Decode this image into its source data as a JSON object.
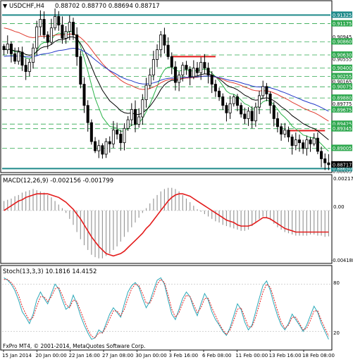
{
  "header": {
    "symbol": "USDCHF,H4",
    "ohlc": "0.88702 0.88770 0.88694 0.88717"
  },
  "macd": {
    "label": "MACD(12,26,9) -0.002156 -0.001799",
    "ticks": [
      "0.002177",
      "0.00",
      "-0.004188"
    ]
  },
  "stoch": {
    "label": "Stoch(13,3,3) 10.1816 14.4152",
    "ticks": [
      "80",
      "20"
    ]
  },
  "footer": {
    "copyright": "FxPro MT4, © 2001-2014, MetaQuotes Software Corp."
  },
  "x_labels": [
    "15 Jan 2014",
    "20 Jan 00:00",
    "22 Jan 16:00",
    "27 Jan 08:00",
    "30 Jan 00:00",
    "3 Feb 16:00",
    "6 Feb 08:00",
    "11 Feb 00:00",
    "13 Feb 16:00",
    "18 Feb 08:00"
  ],
  "price_labels": {
    "plain": [
      "0.90945",
      "0.90555",
      "0.90165",
      "0.89775",
      "0.89385",
      "0.88995",
      "0.88605"
    ],
    "green": [
      "0.91175",
      "0.90860",
      "0.90630",
      "0.90400",
      "0.90255",
      "0.90075",
      "0.89880",
      "0.89675",
      "0.89425",
      "0.89345",
      "0.89005"
    ],
    "teal": [
      "0.91325",
      "0.88650"
    ],
    "current": "0.88717"
  },
  "colors": {
    "candle": "#000000",
    "ema_fast": "#2bb34a",
    "ema_mid": "#000000",
    "ema_slow_red": "#e03a2e",
    "ema_slow_blue": "#2237c8",
    "teal_level": "#1f8a8a",
    "green_level": "#2fa84f",
    "red_level": "#e31b1b",
    "macd_signal": "#e31b1b",
    "stoch_main": "#2aa8b8",
    "stoch_signal": "#e31b1b"
  },
  "chart_data": {
    "type": "candlestick",
    "price_range": [
      0.88605,
      0.9155
    ],
    "teal_levels": [
      0.91325,
      0.8865
    ],
    "green_levels": [
      0.91175,
      0.9086,
      0.9063,
      0.904,
      0.90255,
      0.90075,
      0.8988,
      0.89675,
      0.89425,
      0.89345,
      0.89005
    ],
    "red_levels": [
      {
        "price": 0.906,
        "from_bar": 46,
        "to_bar": 58
      },
      {
        "price": 0.8931,
        "from_bar": 78,
        "to_bar": 88
      }
    ],
    "closes": [
      0.9072,
      0.9082,
      0.9065,
      0.9052,
      0.9068,
      0.9045,
      0.9034,
      0.905,
      0.9075,
      0.9112,
      0.9125,
      0.9098,
      0.9085,
      0.911,
      0.913,
      0.9115,
      0.9092,
      0.9104,
      0.912,
      0.9098,
      0.906,
      0.9012,
      0.8975,
      0.8945,
      0.8912,
      0.8896,
      0.8905,
      0.889,
      0.8912,
      0.8908,
      0.8932,
      0.8925,
      0.891,
      0.8935,
      0.895,
      0.8968,
      0.8942,
      0.8955,
      0.8985,
      0.901,
      0.9028,
      0.9055,
      0.9072,
      0.9098,
      0.908,
      0.906,
      0.9042,
      0.9015,
      0.9028,
      0.9045,
      0.9038,
      0.9025,
      0.904,
      0.9032,
      0.905,
      0.904,
      0.9028,
      0.9012,
      0.9,
      0.899,
      0.8975,
      0.8962,
      0.8978,
      0.899,
      0.8975,
      0.896,
      0.8952,
      0.8965,
      0.8948,
      0.8972,
      0.8992,
      0.9008,
      0.8995,
      0.8975,
      0.8952,
      0.8938,
      0.8925,
      0.8932,
      0.892,
      0.8905,
      0.8915,
      0.891,
      0.89,
      0.8915,
      0.8908,
      0.8918,
      0.8895,
      0.8882,
      0.8875,
      0.88717
    ],
    "macd_hist": [
      0.0008,
      0.0009,
      0.001,
      0.0012,
      0.0013,
      0.0015,
      0.0016,
      0.0017,
      0.0018,
      0.0017,
      0.0016,
      0.0015,
      0.0013,
      0.0011,
      0.0008,
      0.0005,
      0.0002,
      -0.0002,
      -0.0007,
      -0.0012,
      -0.0018,
      -0.0024,
      -0.0029,
      -0.0033,
      -0.0037,
      -0.0039,
      -0.004,
      -0.004,
      -0.0038,
      -0.0036,
      -0.0033,
      -0.003,
      -0.0026,
      -0.0022,
      -0.0018,
      -0.0014,
      -0.001,
      -0.0006,
      -0.0002,
      0.0002,
      0.0006,
      0.001,
      0.0013,
      0.0016,
      0.0018,
      0.0019,
      0.0019,
      0.0018,
      0.0016,
      0.0013,
      0.001,
      0.0007,
      0.0004,
      0.0001,
      -0.0001,
      -0.0003,
      -0.0005,
      -0.0007,
      -0.0009,
      -0.001,
      -0.0012,
      -0.0013,
      -0.0014,
      -0.0015,
      -0.0016,
      -0.0017,
      -0.0017,
      -0.0016,
      -0.0013,
      -0.001,
      -0.0007,
      -0.0005,
      -0.0006,
      -0.0008,
      -0.0011,
      -0.0014,
      -0.0016,
      -0.0018,
      -0.0019,
      -0.002,
      -0.0021,
      -0.0021,
      -0.0021,
      -0.0021,
      -0.002,
      -0.002,
      -0.0021,
      -0.0021,
      -0.0022,
      -0.00216
    ],
    "macd_signal": [
      0.0,
      0.0002,
      0.0004,
      0.0006,
      0.0008,
      0.0009,
      0.0011,
      0.0012,
      0.0013,
      0.0014,
      0.0014,
      0.0014,
      0.0014,
      0.0013,
      0.0012,
      0.0011,
      0.0009,
      0.0007,
      0.0004,
      0.0001,
      -0.0003,
      -0.0007,
      -0.0012,
      -0.0017,
      -0.0022,
      -0.0026,
      -0.003,
      -0.0033,
      -0.0036,
      -0.0037,
      -0.0038,
      -0.0037,
      -0.0036,
      -0.0034,
      -0.0031,
      -0.0028,
      -0.0025,
      -0.0022,
      -0.0019,
      -0.0015,
      -0.0012,
      -0.0008,
      -0.0004,
      0.0,
      0.0004,
      0.0008,
      0.0011,
      0.0013,
      0.0014,
      0.0014,
      0.0013,
      0.0012,
      0.001,
      0.0008,
      0.0006,
      0.0004,
      0.0002,
      0.0,
      -0.0002,
      -0.0004,
      -0.0006,
      -0.0008,
      -0.0009,
      -0.001,
      -0.0012,
      -0.0013,
      -0.0013,
      -0.0013,
      -0.0012,
      -0.001,
      -0.0008,
      -0.0006,
      -0.0006,
      -0.0007,
      -0.0009,
      -0.0011,
      -0.0013,
      -0.0015,
      -0.0016,
      -0.0017,
      -0.0018,
      -0.0018,
      -0.0018,
      -0.0018,
      -0.0018,
      -0.0018,
      -0.0018,
      -0.0018,
      -0.0018,
      -0.001799
    ],
    "stoch_main": [
      88,
      85,
      80,
      72,
      60,
      45,
      38,
      30,
      42,
      60,
      70,
      62,
      55,
      68,
      80,
      74,
      60,
      48,
      52,
      66,
      55,
      40,
      28,
      18,
      10,
      12,
      22,
      18,
      30,
      42,
      50,
      44,
      38,
      55,
      70,
      78,
      82,
      76,
      62,
      50,
      58,
      72,
      85,
      88,
      80,
      60,
      42,
      35,
      48,
      62,
      70,
      64,
      50,
      40,
      55,
      68,
      60,
      45,
      35,
      28,
      20,
      15,
      25,
      40,
      55,
      48,
      32,
      22,
      28,
      45,
      62,
      78,
      84,
      72,
      55,
      40,
      28,
      22,
      30,
      42,
      35,
      28,
      20,
      28,
      40,
      52,
      44,
      30,
      20,
      10
    ],
    "stoch_signal": [
      86,
      86,
      82,
      76,
      66,
      52,
      42,
      34,
      38,
      52,
      64,
      64,
      58,
      64,
      74,
      76,
      66,
      54,
      50,
      60,
      58,
      46,
      34,
      22,
      14,
      12,
      18,
      18,
      26,
      36,
      46,
      46,
      40,
      48,
      62,
      74,
      80,
      78,
      68,
      56,
      56,
      66,
      80,
      86,
      82,
      66,
      48,
      38,
      44,
      56,
      66,
      64,
      54,
      44,
      50,
      62,
      62,
      50,
      40,
      30,
      22,
      16,
      22,
      34,
      48,
      50,
      38,
      26,
      26,
      38,
      54,
      70,
      80,
      76,
      62,
      46,
      32,
      24,
      28,
      38,
      38,
      30,
      22,
      24,
      34,
      46,
      46,
      34,
      24,
      14
    ]
  }
}
